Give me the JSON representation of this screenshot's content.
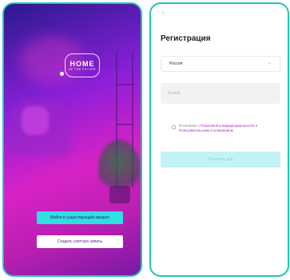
{
  "left_screen": {
    "logo_main": "HOME",
    "logo_sub": "OF THE FUTURE",
    "login_button": "Войти в существующий аккаунт",
    "create_button": "Создать учетную запись"
  },
  "right_screen": {
    "back_glyph": "‹",
    "title": "Регистрация",
    "country_select": "Россия",
    "email_placeholder": "E-mail",
    "consent_prefix": "Я согласен с ",
    "consent_link_policy": "Политикой конфиденциальности",
    "consent_and": " и ",
    "consent_link_terms": "Пользовательским Соглашением",
    "submit_button": "Получить код"
  },
  "colors": {
    "accent": "#1fc6b4",
    "cta": "#2ee0e0",
    "link": "#b020c8"
  }
}
